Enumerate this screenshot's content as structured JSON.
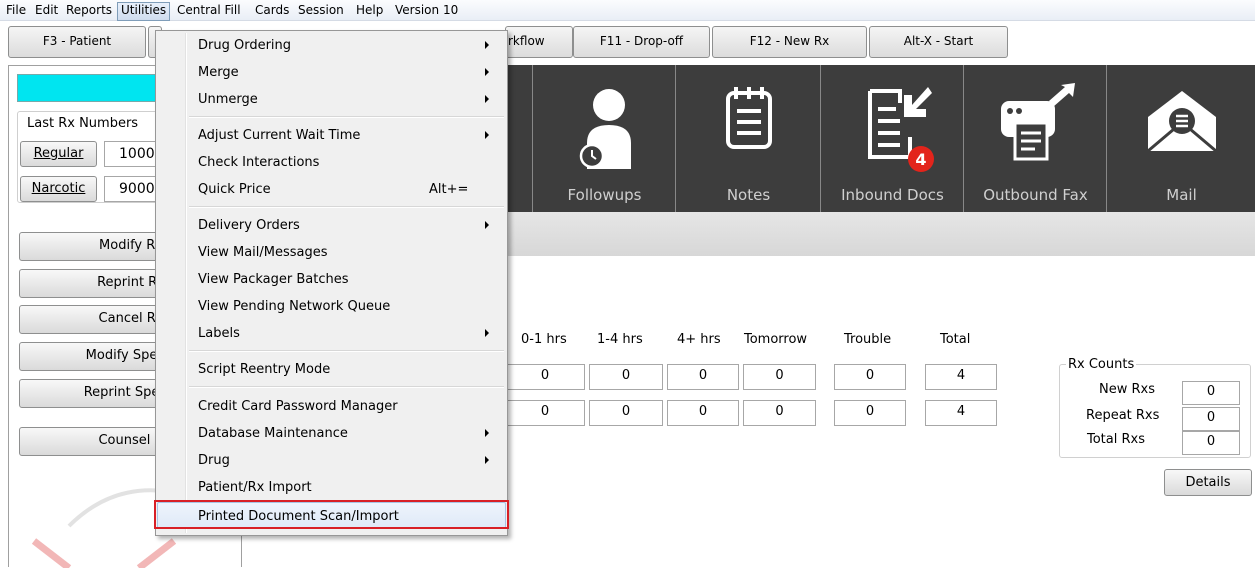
{
  "menubar": {
    "items": [
      "File",
      "Edit",
      "Reports",
      "Utilities",
      "Central Fill",
      "Cards",
      "Session",
      "Help",
      "Version 10"
    ],
    "active": "Utilities"
  },
  "toolbar": {
    "buttons": [
      "F3 - Patient",
      "rkflow",
      "F11 - Drop-off",
      "F12 - New Rx",
      "Alt-X - Start"
    ]
  },
  "left": {
    "last_rx_label": "Last Rx Numbers",
    "regular_label": "Regular",
    "regular_value": "1000",
    "narcotic_label": "Narcotic",
    "narcotic_value": "9000",
    "buttons": [
      "Modify Rx",
      "Reprint Rx",
      "Cancel Rx",
      "Modify Specifi",
      "Reprint Specifi",
      "Counsel R"
    ]
  },
  "tiles": [
    {
      "label": "Followups",
      "icon": "followups-icon"
    },
    {
      "label": "Notes",
      "icon": "notes-icon"
    },
    {
      "label": "Inbound Docs",
      "icon": "inbound-docs-icon",
      "badge": "4"
    },
    {
      "label": "Outbound Fax",
      "icon": "outbound-fax-icon"
    },
    {
      "label": "Mail",
      "icon": "mail-icon"
    }
  ],
  "wait_table": {
    "headers": [
      "0-1 hrs",
      "1-4 hrs",
      "4+ hrs",
      "Tomorrow",
      "Trouble",
      "Total"
    ],
    "rows": [
      [
        "0",
        "0",
        "0",
        "0",
        "0",
        "4"
      ],
      [
        "0",
        "0",
        "0",
        "0",
        "0",
        "4"
      ]
    ]
  },
  "rx_counts": {
    "title": "Rx Counts",
    "new_label": "New Rxs",
    "new_value": "0",
    "repeat_label": "Repeat Rxs",
    "repeat_value": "0",
    "total_label": "Total Rxs",
    "total_value": "0",
    "details_label": "Details"
  },
  "menu": {
    "items": [
      {
        "label": "Drug Ordering",
        "submenu": true
      },
      {
        "label": "Merge",
        "submenu": true
      },
      {
        "label": "Unmerge",
        "submenu": true
      },
      {
        "label": "Adjust Current Wait Time",
        "submenu": true
      },
      {
        "label": "Check Interactions"
      },
      {
        "label": "Quick Price",
        "shortcut": "Alt+="
      },
      {
        "label": "Delivery Orders",
        "submenu": true
      },
      {
        "label": "View Mail/Messages"
      },
      {
        "label": "View Packager Batches"
      },
      {
        "label": "View Pending Network Queue"
      },
      {
        "label": "Labels",
        "submenu": true
      },
      {
        "label": "Script Reentry Mode"
      },
      {
        "label": "Credit Card Password Manager"
      },
      {
        "label": "Database Maintenance",
        "submenu": true
      },
      {
        "label": "Drug",
        "submenu": true
      },
      {
        "label": "Patient/Rx Import"
      },
      {
        "label": "Printed Document Scan/Import",
        "highlighted": true
      }
    ]
  },
  "colors": {
    "accent_cyan": "#00e5f0",
    "icon_bar": "#3d3d3d",
    "badge_red": "#e3241b",
    "highlight_box": "#d81f26"
  }
}
